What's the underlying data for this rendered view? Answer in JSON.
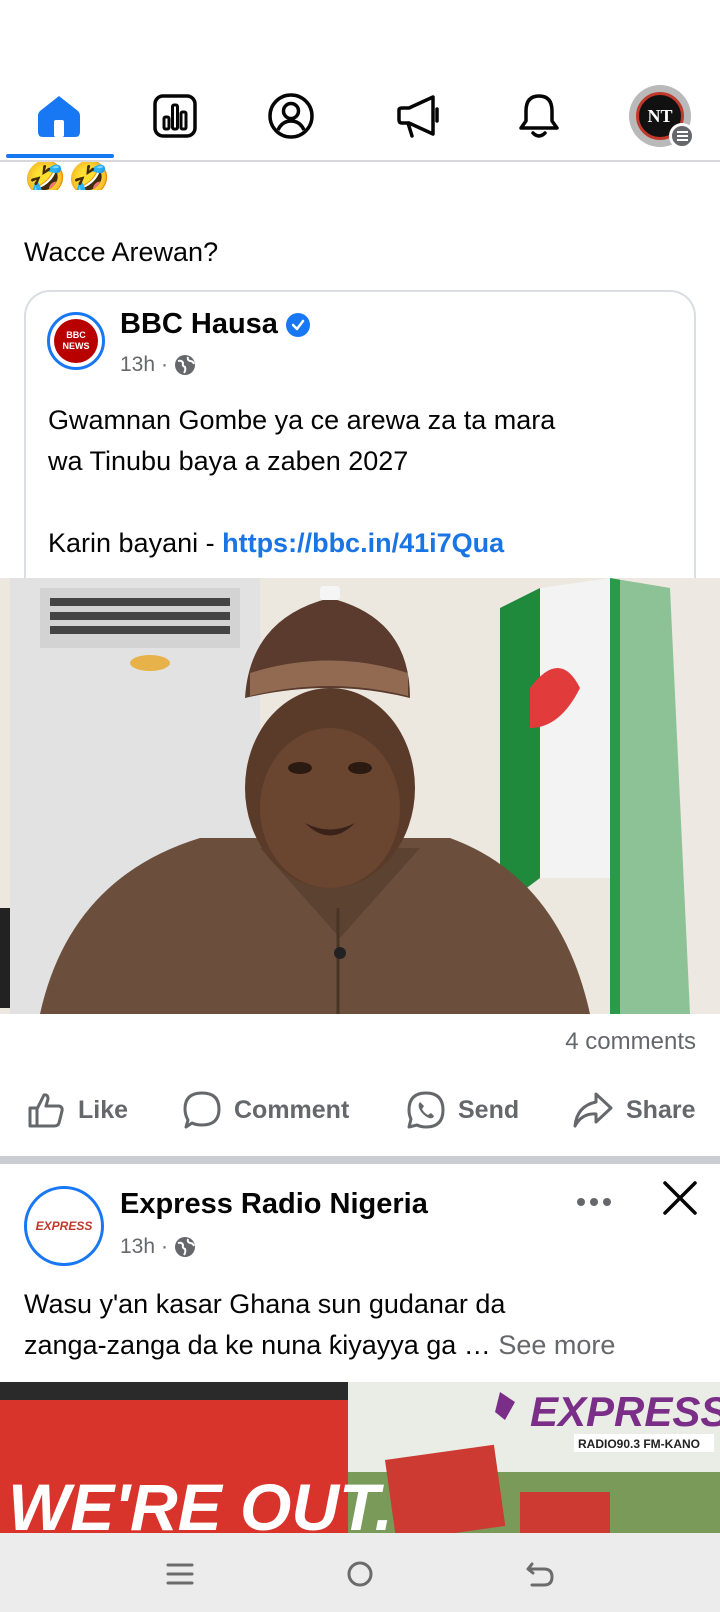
{
  "nav": {
    "tabs": [
      {
        "name": "home",
        "icon": "home-icon",
        "active": true
      },
      {
        "name": "dashboard",
        "icon": "bar-chart-icon"
      },
      {
        "name": "profile",
        "icon": "profile-icon"
      },
      {
        "name": "ads",
        "icon": "megaphone-icon"
      },
      {
        "name": "notifications",
        "icon": "bell-icon"
      },
      {
        "name": "menu",
        "icon": "avatar-icon"
      }
    ],
    "avatar_text": "NT",
    "accent": "#1877f2"
  },
  "post1": {
    "emoji": "🤣🤣",
    "text": "Wacce Arewan?",
    "shared": {
      "page_name": "BBC Hausa",
      "logo_line1": "BBC",
      "logo_line2": "NEWS",
      "time": "13h",
      "body_line1": "Gwamnan Gombe ya ce arewa za ta mara",
      "body_line2": "wa Tinubu baya a zaben 2027",
      "more_label": "Karin bayani - ",
      "link": "https://bbc.in/41i7Qua"
    },
    "comments_count": "4 comments",
    "actions": {
      "like": "Like",
      "comment": "Comment",
      "send": "Send",
      "share": "Share"
    }
  },
  "post2": {
    "page_name": "Express Radio Nigeria",
    "logo_text": "EXPRESS",
    "time": "13h",
    "body_line1": "Wasu y'an kasar Ghana sun gudanar da",
    "body_line2": "zanga-zanga da ke nuna ƙiyayya ga …",
    "see_more": "See more",
    "banner_left": "WE'RE OUT.",
    "banner_brand": "EXPRESS",
    "banner_sub": "RADIO90.3 FM-KANO"
  }
}
